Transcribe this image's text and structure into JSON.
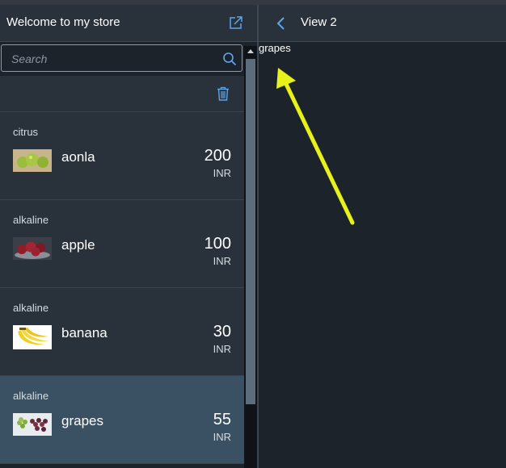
{
  "master": {
    "title": "Welcome to my store",
    "search": {
      "placeholder": "Search",
      "value": ""
    },
    "items": [
      {
        "category": "citrus",
        "name": "aonla",
        "price": "200",
        "currency": "INR",
        "selected": false
      },
      {
        "category": "alkaline",
        "name": "apple",
        "price": "100",
        "currency": "INR",
        "selected": false
      },
      {
        "category": "alkaline",
        "name": "banana",
        "price": "30",
        "currency": "INR",
        "selected": false
      },
      {
        "category": "alkaline",
        "name": "grapes",
        "price": "55",
        "currency": "INR",
        "selected": true
      }
    ]
  },
  "detail": {
    "title": "View 2",
    "content": "grapes"
  },
  "icons": {
    "share": "share-icon",
    "search": "search-icon",
    "delete": "trash-icon",
    "back": "chevron-left-icon",
    "annotation": "arrow-icon"
  },
  "colors": {
    "accent": "#5ea6ee",
    "header_bg": "#29313a",
    "page_bg": "#1d232a",
    "selected_row": "#3a5063",
    "annotation_arrow": "#e6f21a"
  }
}
